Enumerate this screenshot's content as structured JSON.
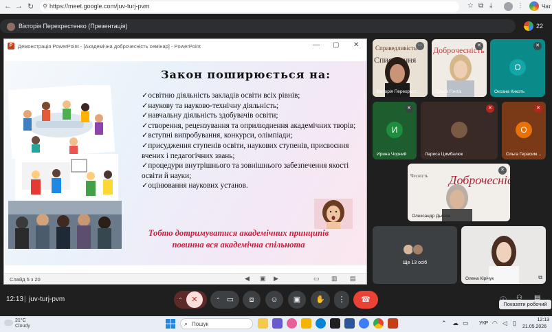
{
  "browser": {
    "url": "https://meet.google.com/juv-turj-pvm",
    "chat_label": "Чат"
  },
  "meet": {
    "presenter_title": "Вікторія Перехрестенко (Презентація)",
    "people_count": "22",
    "meeting_time": "12:13",
    "meeting_code": "juv-turj-pvm",
    "tooltip": "Показати робочий стіл"
  },
  "ppt": {
    "window_title": "Демонстрація PowerPoint - [Академічна доброчесність семінар] - PowerPoint",
    "slide_counter": "Слайд 5 з 20",
    "heading": "Закон поширюється на:",
    "bullets": [
      "✓освітню діяльність закладів освіти всіх рівнів;",
      "✓наукову та науково-технічну діяльність;",
      "✓навчальну діяльність здобувачів освіти;",
      "✓створення, рецензування та оприлюднення академічних творів;",
      "✓вступні випробування, конкурси, олімпіади;",
      "✓присудження ступенів освіти, наукових ступенів, присвоєння вчених і педагогічних звань;",
      "✓процедури внутрішнього та зовнішнього забезпечення якості освіти й науки;",
      "✓оцінювання наукових установ."
    ],
    "footer": "Тобто дотримуватися академічних принципів повинна вся академічна спільнота"
  },
  "tiles": [
    {
      "name": "Вікторія Перехрест…"
    },
    {
      "name": "Ольга Гонта"
    },
    {
      "name": "Оксана Кикоть",
      "letter": "О",
      "color": "#0b8a8a"
    },
    {
      "name": "Ирина Чорний",
      "letter": "И",
      "color": "#1e8e3e"
    },
    {
      "name": "Лариса Цимбалюк"
    },
    {
      "name": "Ольга Герасим…",
      "letter": "О",
      "color": "#e8710a"
    },
    {
      "name": "Олександр Дьячок"
    },
    {
      "name": "Ще 13 осіб"
    },
    {
      "name": "Олена Кірічук"
    }
  ],
  "slide_bg_words": [
    "Справедливість",
    "Доброчесність",
    "Списування",
    "Чесність"
  ],
  "taskbar": {
    "weather_temp": "21°C",
    "weather_desc": "Cloudy",
    "search_placeholder": "Пошук",
    "lang": "УКР",
    "time": "12:13",
    "date": "21.05.2026"
  },
  "colors": {
    "end_call": "#ea4335",
    "slide_footer": "#c81e3c",
    "meet_bg": "#1f1f1f"
  }
}
